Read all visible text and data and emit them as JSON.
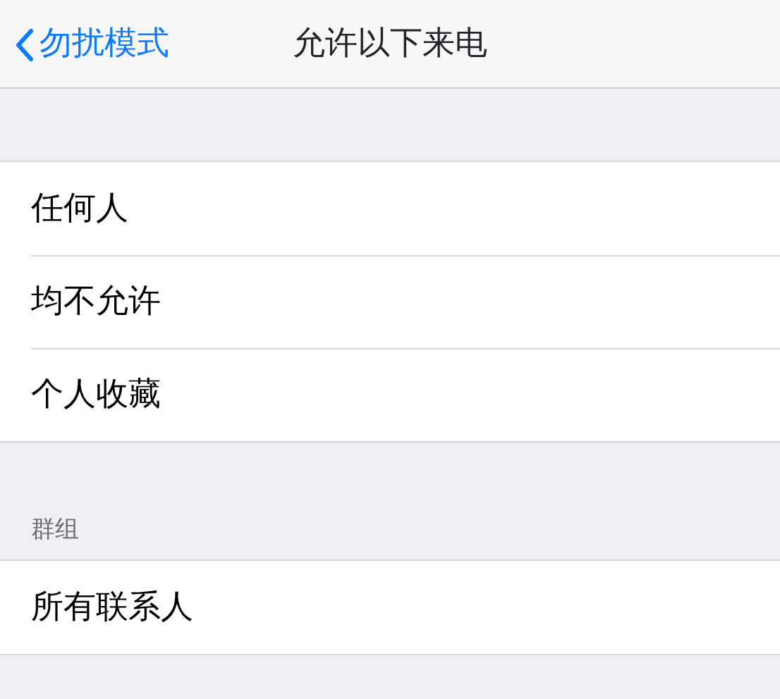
{
  "nav": {
    "back": "勿扰模式",
    "title": "允许以下来电"
  },
  "sections": [
    {
      "items": [
        {
          "label": "任何人"
        },
        {
          "label": "均不允许"
        },
        {
          "label": "个人收藏"
        }
      ]
    },
    {
      "header": "群组",
      "items": [
        {
          "label": "所有联系人"
        }
      ]
    }
  ]
}
